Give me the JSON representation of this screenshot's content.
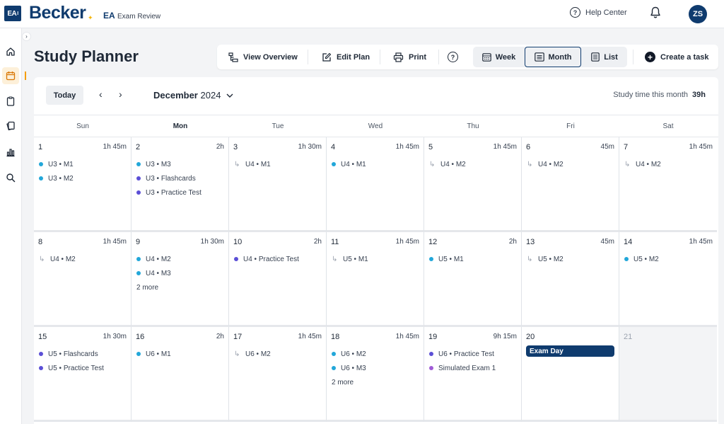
{
  "topbar": {
    "logo": "EA",
    "brand": "Becker",
    "product_code": "EA",
    "product_name": "Exam Review",
    "help_label": "Help Center",
    "avatar_initials": "ZS"
  },
  "sidebar": {
    "collapse_icon": "chevron-right-icon",
    "items": [
      "home-icon",
      "calendar-icon",
      "clipboard-icon",
      "flashcards-icon",
      "chart-icon",
      "search-icon"
    ]
  },
  "page": {
    "title": "Study Planner"
  },
  "toolbar": {
    "view_overview": "View Overview",
    "edit_plan": "Edit Plan",
    "print": "Print",
    "help": "?",
    "week": "Week",
    "month": "Month",
    "list": "List",
    "create_task": "Create a task"
  },
  "calendar": {
    "today_label": "Today",
    "month_name": "December",
    "year": "2024",
    "study_time_label": "Study time this month",
    "study_time_value": "39h",
    "weekdays": [
      "Sun",
      "Mon",
      "Tue",
      "Wed",
      "Thu",
      "Fri",
      "Sat"
    ],
    "current_weekday_index": 1,
    "colors": {
      "cyan": "#22a7d9",
      "indigo": "#5b4fd6",
      "purple": "#a05bd6",
      "exam": "#0f3b6e"
    },
    "weeks": [
      [
        {
          "day": "1",
          "time": "1h 45m",
          "tasks": [
            {
              "type": "dot",
              "color": "cyan",
              "label": "U3 • M1"
            },
            {
              "type": "dot",
              "color": "cyan",
              "label": "U3 • M2"
            }
          ]
        },
        {
          "day": "2",
          "time": "2h",
          "tasks": [
            {
              "type": "dot",
              "color": "cyan",
              "label": "U3 • M3"
            },
            {
              "type": "dot",
              "color": "indigo",
              "label": "U3 • Flashcards"
            },
            {
              "type": "dot",
              "color": "indigo",
              "label": "U3 • Practice Test"
            }
          ]
        },
        {
          "day": "3",
          "time": "1h 30m",
          "tasks": [
            {
              "type": "arrow",
              "label": "U4 • M1"
            }
          ]
        },
        {
          "day": "4",
          "time": "1h 45m",
          "tasks": [
            {
              "type": "dot",
              "color": "cyan",
              "label": "U4 • M1"
            }
          ]
        },
        {
          "day": "5",
          "time": "1h 45m",
          "tasks": [
            {
              "type": "arrow",
              "label": "U4 • M2"
            }
          ]
        },
        {
          "day": "6",
          "time": "45m",
          "tasks": [
            {
              "type": "arrow",
              "label": "U4 • M2"
            }
          ]
        },
        {
          "day": "7",
          "time": "1h 45m",
          "tasks": [
            {
              "type": "arrow",
              "label": "U4 • M2"
            }
          ]
        }
      ],
      [
        {
          "day": "8",
          "time": "1h 45m",
          "tasks": [
            {
              "type": "arrow",
              "label": "U4 • M2"
            }
          ]
        },
        {
          "day": "9",
          "time": "1h 30m",
          "tasks": [
            {
              "type": "dot",
              "color": "cyan",
              "label": "U4 • M2"
            },
            {
              "type": "dot",
              "color": "cyan",
              "label": "U4 • M3"
            }
          ],
          "more": "2  more"
        },
        {
          "day": "10",
          "time": "2h",
          "tasks": [
            {
              "type": "dot",
              "color": "indigo",
              "label": "U4 • Practice Test"
            }
          ]
        },
        {
          "day": "11",
          "time": "1h 45m",
          "tasks": [
            {
              "type": "arrow",
              "label": "U5 • M1"
            }
          ]
        },
        {
          "day": "12",
          "time": "2h",
          "tasks": [
            {
              "type": "dot",
              "color": "cyan",
              "label": "U5 • M1"
            }
          ]
        },
        {
          "day": "13",
          "time": "45m",
          "tasks": [
            {
              "type": "arrow",
              "label": "U5 • M2"
            }
          ]
        },
        {
          "day": "14",
          "time": "1h 45m",
          "tasks": [
            {
              "type": "dot",
              "color": "cyan",
              "label": "U5 • M2"
            }
          ]
        }
      ],
      [
        {
          "day": "15",
          "time": "1h 30m",
          "tasks": [
            {
              "type": "dot",
              "color": "indigo",
              "label": "U5 • Flashcards"
            },
            {
              "type": "dot",
              "color": "indigo",
              "label": "U5 • Practice Test"
            }
          ]
        },
        {
          "day": "16",
          "time": "2h",
          "tasks": [
            {
              "type": "dot",
              "color": "cyan",
              "label": "U6 • M1"
            }
          ]
        },
        {
          "day": "17",
          "time": "1h 45m",
          "tasks": [
            {
              "type": "arrow",
              "label": "U6 • M2"
            }
          ]
        },
        {
          "day": "18",
          "time": "1h 45m",
          "tasks": [
            {
              "type": "dot",
              "color": "cyan",
              "label": "U6 • M2"
            },
            {
              "type": "dot",
              "color": "cyan",
              "label": "U6 • M3"
            }
          ],
          "more": "2  more"
        },
        {
          "day": "19",
          "time": "9h 15m",
          "tasks": [
            {
              "type": "dot",
              "color": "indigo",
              "label": "U6 • Practice Test"
            },
            {
              "type": "dot",
              "color": "purple",
              "label": "Simulated Exam 1"
            }
          ]
        },
        {
          "day": "20",
          "time": "",
          "exam": "Exam Day",
          "tasks": []
        },
        {
          "day": "21",
          "time": "",
          "disabled": true,
          "tasks": []
        }
      ]
    ]
  }
}
